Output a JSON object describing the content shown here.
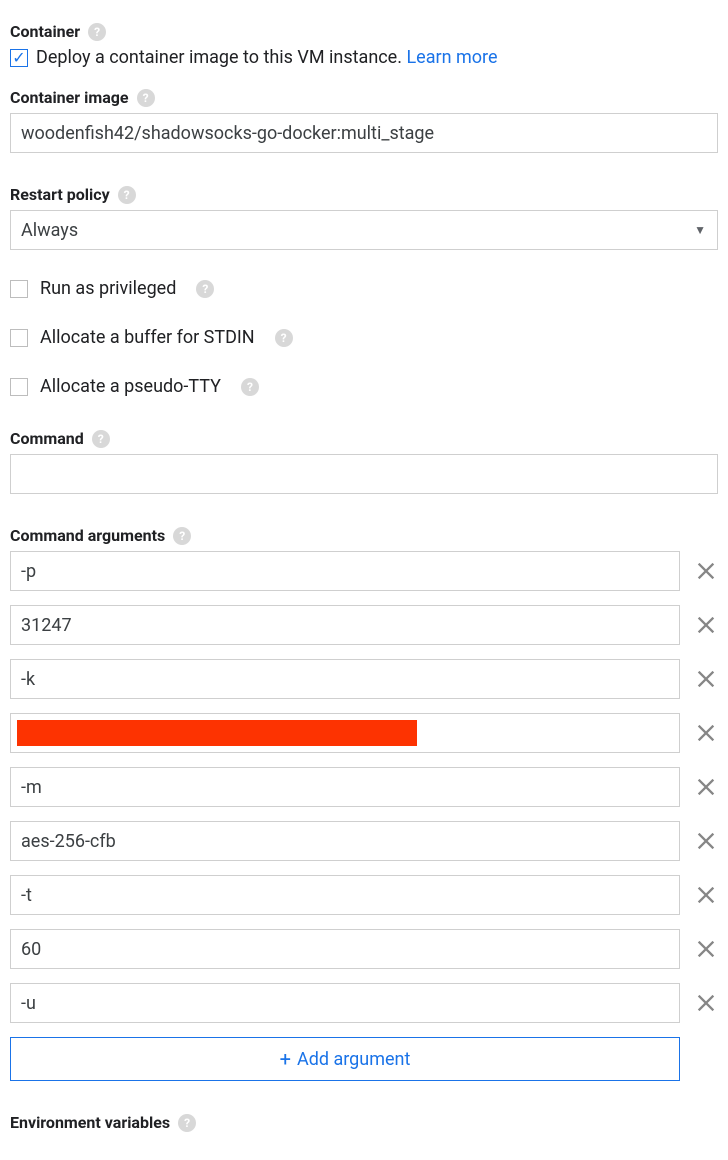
{
  "container": {
    "label": "Container",
    "deploy_text": "Deploy a container image to this VM instance.",
    "learn_more": "Learn more",
    "deploy_checked": true
  },
  "container_image": {
    "label": "Container image",
    "value": "woodenfish42/shadowsocks-go-docker:multi_stage"
  },
  "restart_policy": {
    "label": "Restart policy",
    "value": "Always"
  },
  "options": {
    "privileged": {
      "label": "Run as privileged",
      "checked": false
    },
    "stdin": {
      "label": "Allocate a buffer for STDIN",
      "checked": false
    },
    "tty": {
      "label": "Allocate a pseudo-TTY",
      "checked": false
    }
  },
  "command": {
    "label": "Command",
    "value": ""
  },
  "command_args": {
    "label": "Command arguments",
    "items": [
      {
        "value": "-p",
        "redacted": false
      },
      {
        "value": "31247",
        "redacted": false
      },
      {
        "value": "-k",
        "redacted": false
      },
      {
        "value": "",
        "redacted": true
      },
      {
        "value": "-m",
        "redacted": false
      },
      {
        "value": "aes-256-cfb",
        "redacted": false
      },
      {
        "value": "-t",
        "redacted": false
      },
      {
        "value": "60",
        "redacted": false
      },
      {
        "value": "-u",
        "redacted": false
      }
    ],
    "add_label": "Add argument"
  },
  "env_vars": {
    "label": "Environment variables"
  }
}
